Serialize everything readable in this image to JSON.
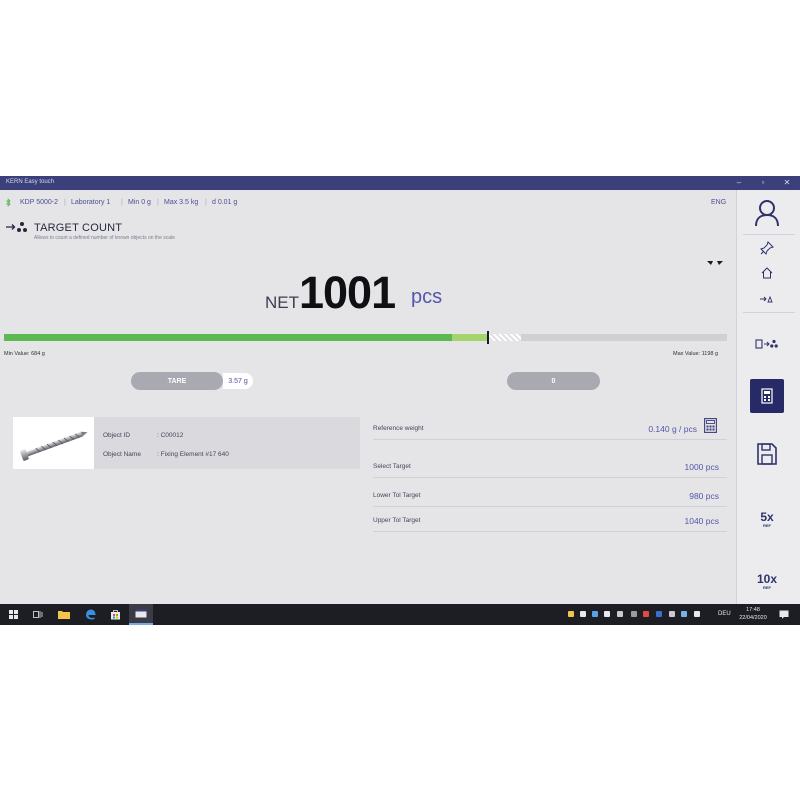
{
  "window": {
    "title": "KERN Easy touch",
    "minimize": "–",
    "maximize": "▫",
    "close": "✕"
  },
  "infobar": {
    "model": "KDP 5000-2",
    "location": "Laboratory 1",
    "min": "Min 0 g",
    "max": "Max 3.5 kg",
    "d": "d 0.01 g",
    "language": "ENG"
  },
  "mode": {
    "title": "TARGET COUNT",
    "subtitle": "Allows to count a defined number of known objects on the scale"
  },
  "reading": {
    "label": "NET",
    "value": "1001",
    "unit": "pcs"
  },
  "progress": {
    "fill_fraction": 0.62,
    "tolerance_start_fraction": 0.62,
    "tolerance_end_fraction": 0.715,
    "marker_fraction": 0.67,
    "min_label": "Min Value: 684 g",
    "max_label": "Max Value: 1198 g"
  },
  "actions": {
    "tare_label": "TARE",
    "tare_value": "3.57 g",
    "zero_label": "0"
  },
  "object": {
    "id_label": "Object ID",
    "id_value": ": C00012",
    "name_label": "Object Name",
    "name_value": ": Fixing Element #17 640"
  },
  "details": {
    "reference_label": "Reference weight",
    "reference_value": "0.140  g / pcs",
    "target_label": "Select Target",
    "target_value": "1000 pcs",
    "lower_label": "Lower Tol Target",
    "lower_value": "980 pcs",
    "upper_label": "Upper Tol Target",
    "upper_value": "1040 pcs"
  },
  "side": {
    "five_ref": "5x",
    "ten_ref": "10x",
    "ref_small": "REF"
  },
  "taskbar": {
    "time": "17:48",
    "date": "22/04/2020",
    "lang": "DEU"
  },
  "colors": {
    "accent": "#5456a8",
    "titlebar": "#3b3f7a",
    "progress_green": "#5cb851",
    "tolerance": "#a6d46c"
  },
  "icons": [
    "person-icon",
    "pin-icon",
    "home-icon",
    "arrow-objects-icon",
    "calculator-icon",
    "save-icon",
    "eye-icon",
    "windows-start-icon",
    "task-view-icon",
    "explorer-icon",
    "edge-icon",
    "store-icon",
    "app-icon"
  ]
}
